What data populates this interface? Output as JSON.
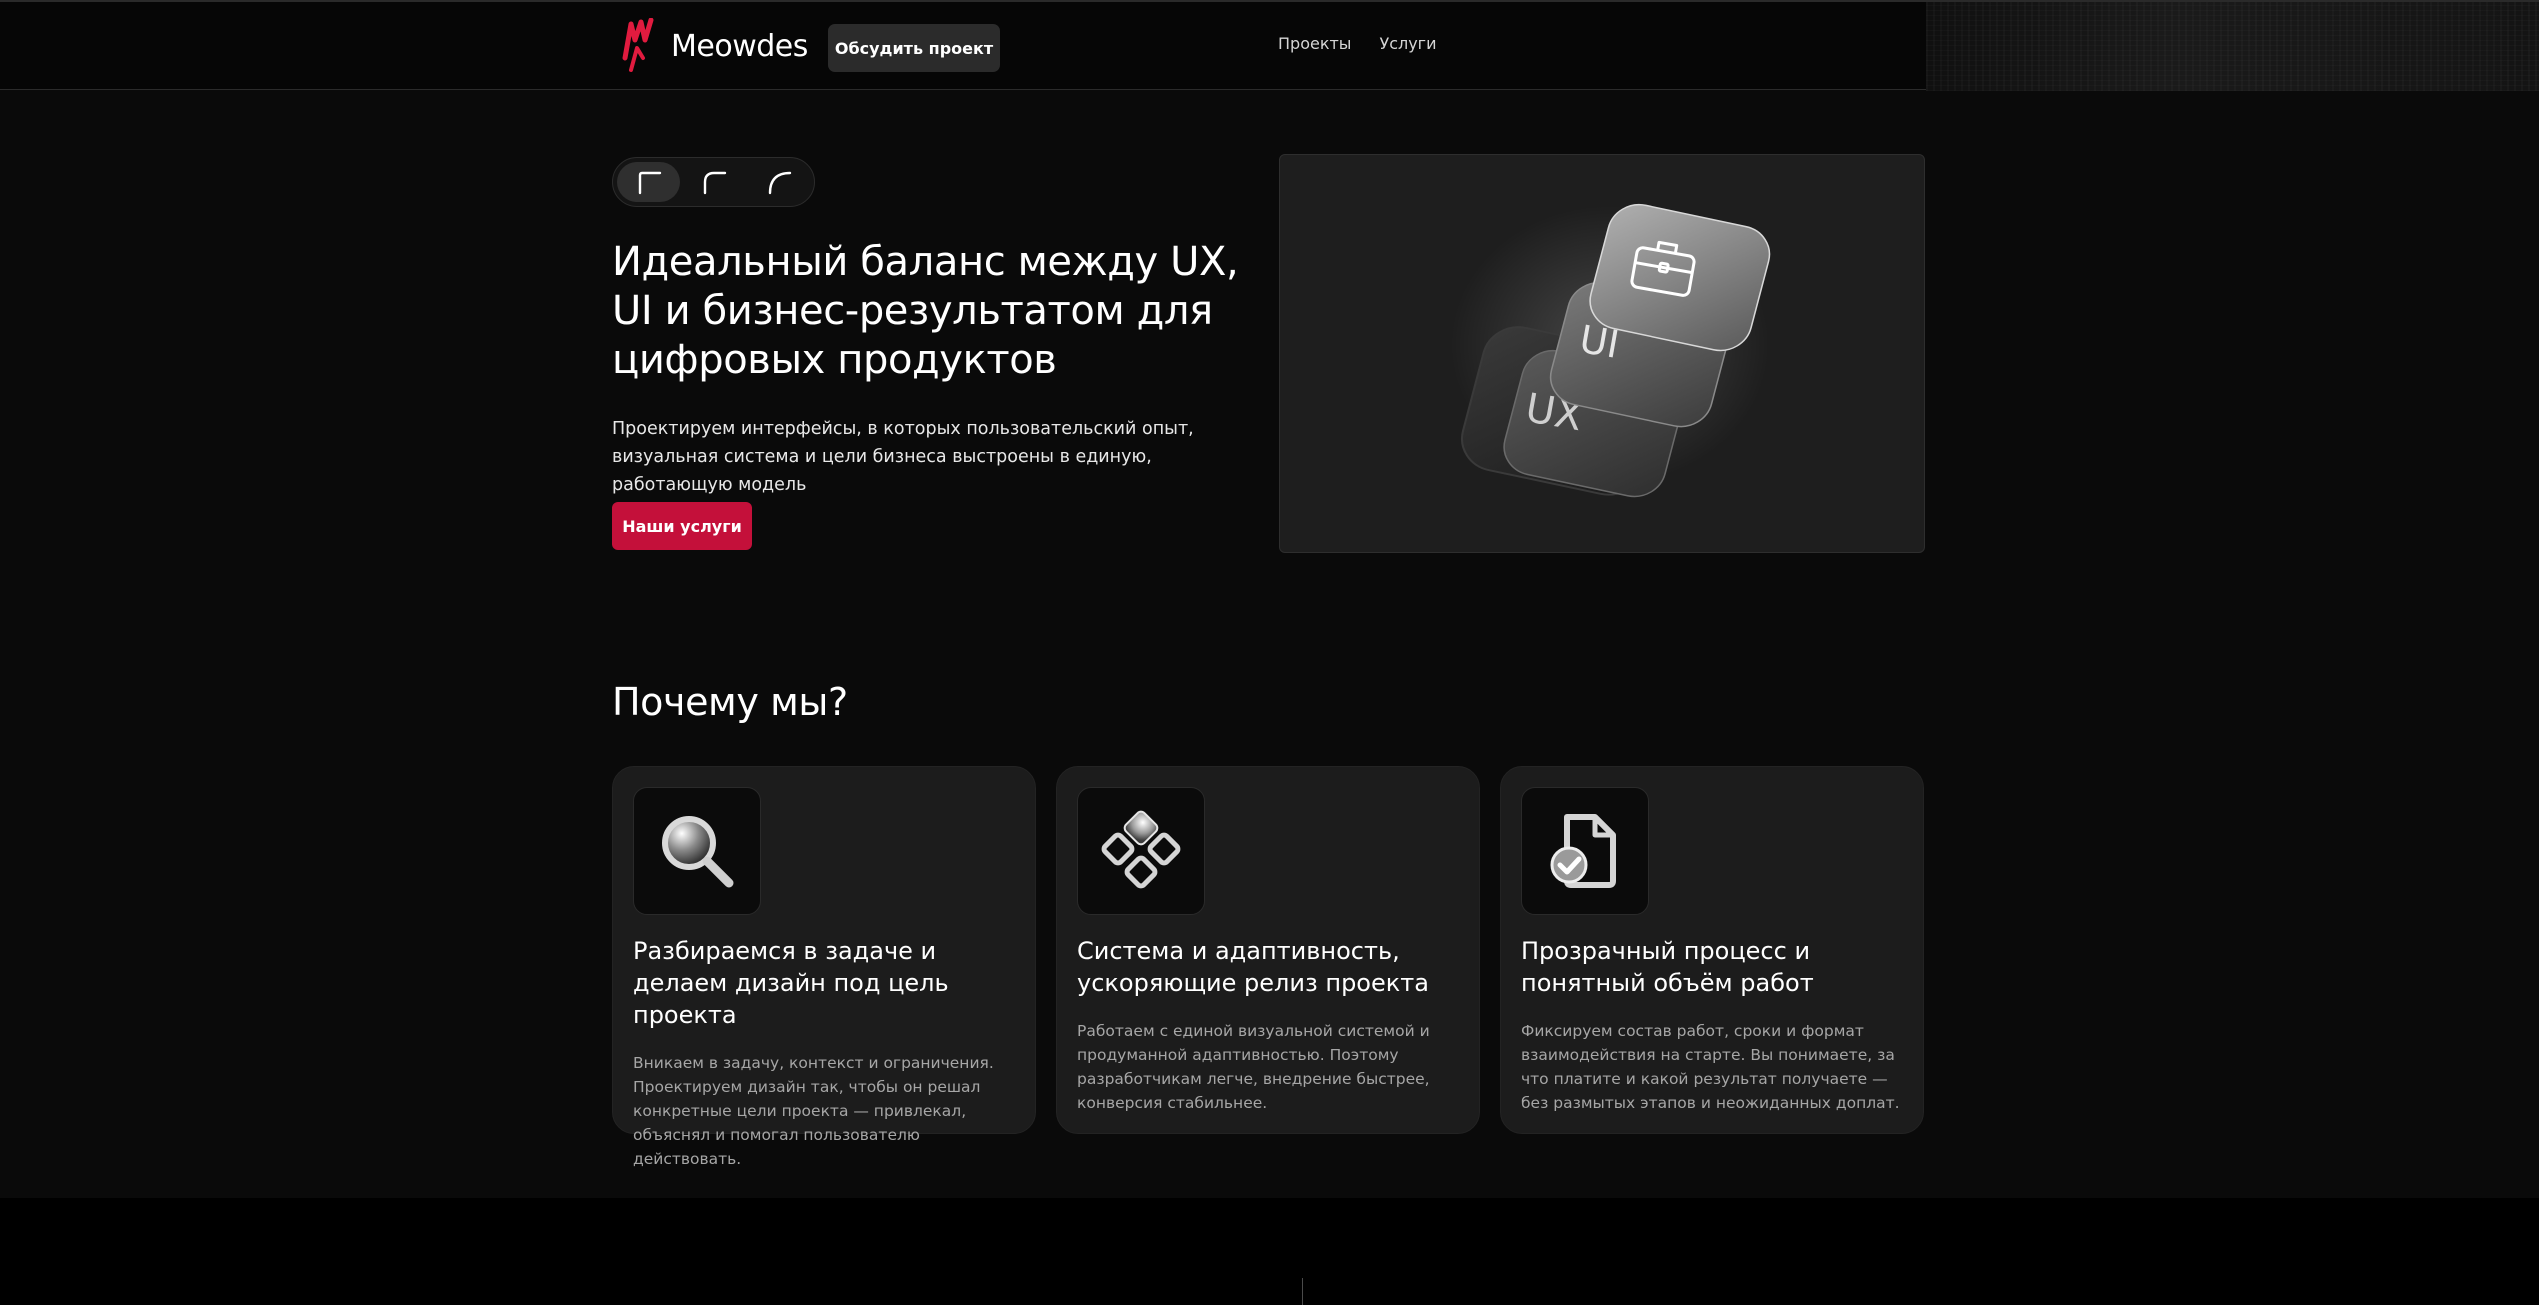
{
  "header": {
    "logo_text": "Meowdes",
    "discuss_button": "Обсудить проект",
    "nav": [
      {
        "label": "Проекты"
      },
      {
        "label": "Услуги"
      }
    ]
  },
  "hero": {
    "title": "Идеальный баланс между UX, UI и бизнес-результатом для цифровых продуктов",
    "subtitle": "Проектируем интерфейсы, в которых пользовательский опыт, визуальная система и цели бизнеса выстроены в единую, работающую модель",
    "cta": "Наши услуги",
    "image_labels": {
      "ux": "UX",
      "ui": "UI"
    },
    "image_icon": "briefcase-icon"
  },
  "why": {
    "title": "Почему мы?",
    "cards": [
      {
        "icon": "magnifier-icon",
        "title": "Разбираемся в задаче и делаем дизайн под цель проекта",
        "text": "Вникаем в задачу, контекст и ограничения. Проектируем дизайн так, чтобы он решал конкретные цели проекта — привлекал, объяснял и помогал пользователю действовать."
      },
      {
        "icon": "component-icon",
        "title": "Система и адаптивность, ускоряющие релиз проекта",
        "text": "Работаем с единой визуальной системой и продуманной адаптивностью. Поэтому разработчикам легче, внедрение быстрее, конверсия стабильнее."
      },
      {
        "icon": "document-check-icon",
        "title": "Прозрачный процесс и понятный объём работ",
        "text": "Фиксируем состав работ, сроки и формат взаимодействия на старте. Вы понимаете, за что платите и какой результат получаете — без размытых этапов и неожиданных доплат."
      }
    ]
  },
  "colors": {
    "accent": "#c4103a",
    "background": "#0a0a0a",
    "card": "#1c1c1c"
  }
}
